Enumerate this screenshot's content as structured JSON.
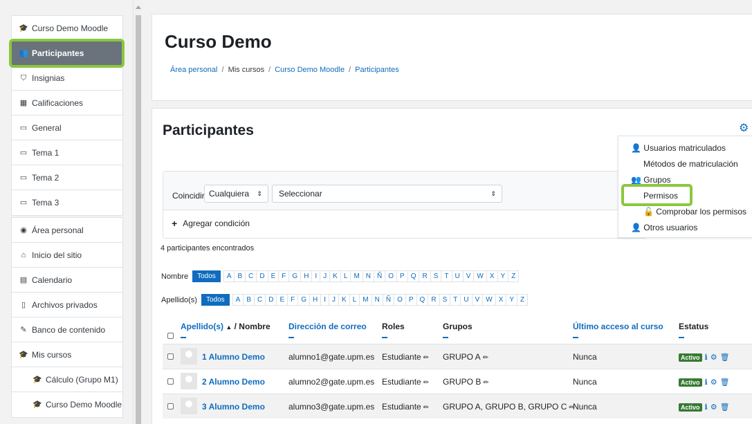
{
  "sidebar": {
    "group1": [
      {
        "label": "Curso Demo Moodle",
        "icon": "graduation-cap-icon"
      },
      {
        "label": "Participantes",
        "icon": "users-icon",
        "active": true
      },
      {
        "label": "Insignias",
        "icon": "shield-icon"
      },
      {
        "label": "Calificaciones",
        "icon": "table-icon"
      },
      {
        "label": "General",
        "icon": "folder-icon"
      },
      {
        "label": "Tema 1",
        "icon": "folder-icon"
      },
      {
        "label": "Tema 2",
        "icon": "folder-icon"
      },
      {
        "label": "Tema 3",
        "icon": "folder-icon"
      }
    ],
    "group2": [
      {
        "label": "Área personal",
        "icon": "dashboard-icon"
      },
      {
        "label": "Inicio del sitio",
        "icon": "home-icon"
      },
      {
        "label": "Calendario",
        "icon": "calendar-icon"
      },
      {
        "label": "Archivos privados",
        "icon": "file-icon"
      },
      {
        "label": "Banco de contenido",
        "icon": "brush-icon"
      },
      {
        "label": "Mis cursos",
        "icon": "graduation-cap-icon"
      },
      {
        "label": "Cálculo (Grupo M1)",
        "icon": "graduation-cap-icon"
      },
      {
        "label": "Curso Demo Moodle",
        "icon": "graduation-cap-icon"
      }
    ]
  },
  "header": {
    "title": "Curso Demo",
    "breadcrumb": [
      "Área personal",
      "Mis cursos",
      "Curso Demo Moodle",
      "Participantes"
    ]
  },
  "main": {
    "title": "Participantes",
    "filter": {
      "match_label": "Coincidir",
      "match_value": "Cualquiera",
      "criteria_value": "Seleccionar",
      "add_condition": "Agregar condición"
    },
    "count_text": "4 participantes encontrados",
    "firstname_label": "Nombre",
    "lastname_label": "Apellido(s)",
    "all_label": "Todos",
    "letters": [
      "A",
      "B",
      "C",
      "D",
      "E",
      "F",
      "G",
      "H",
      "I",
      "J",
      "K",
      "L",
      "M",
      "N",
      "Ñ",
      "O",
      "P",
      "Q",
      "R",
      "S",
      "T",
      "U",
      "V",
      "W",
      "X",
      "Y",
      "Z"
    ],
    "table": {
      "col_lastname": "Apellido(s)",
      "col_sort_up": "▲",
      "col_sep_name": "/ Nombre",
      "col_email": "Dirección de correo",
      "col_roles": "Roles",
      "col_groups": "Grupos",
      "col_lastaccess": "Último acceso al curso",
      "col_status": "Estatus",
      "rows": [
        {
          "name": "1 Alumno Demo",
          "email": "alumno1@gate.upm.es",
          "role": "Estudiante",
          "groups": "GRUPO A",
          "last_access": "Nunca",
          "status": "Activo"
        },
        {
          "name": "2 Alumno Demo",
          "email": "alumno2@gate.upm.es",
          "role": "Estudiante",
          "groups": "GRUPO B",
          "last_access": "Nunca",
          "status": "Activo"
        },
        {
          "name": "3 Alumno Demo",
          "email": "alumno3@gate.upm.es",
          "role": "Estudiante",
          "groups": "GRUPO A, GRUPO B, GRUPO C",
          "last_access": "Nunca",
          "status": "Activo"
        }
      ]
    }
  },
  "dropdown": {
    "items": [
      "Usuarios matriculados",
      "Métodos de matriculación",
      "Grupos",
      "Permisos",
      "Comprobar los permisos",
      "Otros usuarios"
    ]
  },
  "colors": {
    "accent": "#0f6cbf",
    "highlight": "#8cc63f",
    "active_badge": "#357a32"
  }
}
